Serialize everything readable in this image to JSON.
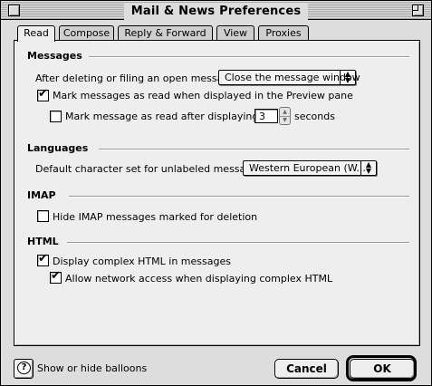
{
  "window": {
    "title": "Mail & News Preferences"
  },
  "tabs": [
    {
      "label": "Read",
      "active": true
    },
    {
      "label": "Compose",
      "active": false
    },
    {
      "label": "Reply & Forward",
      "active": false
    },
    {
      "label": "View",
      "active": false
    },
    {
      "label": "Proxies",
      "active": false
    }
  ],
  "messages": {
    "heading": "Messages",
    "after_delete_label": "After deleting or filing an open message:",
    "after_delete_value": "Close the message window",
    "mark_read_preview": {
      "label": "Mark messages as read when displayed in the Preview pane",
      "checked": true
    },
    "mark_read_after": {
      "label": "Mark message as read after displaying for",
      "checked": false,
      "seconds": "3",
      "unit": "seconds"
    }
  },
  "languages": {
    "heading": "Languages",
    "default_charset_label": "Default character set for unlabeled messages:",
    "default_charset_value": "Western European (W..."
  },
  "imap": {
    "heading": "IMAP",
    "hide_deleted": {
      "label": "Hide IMAP messages marked for deletion",
      "checked": false
    }
  },
  "html": {
    "heading": "HTML",
    "display_complex": {
      "label": "Display complex HTML in messages",
      "checked": true
    },
    "allow_network": {
      "label": "Allow network access when displaying complex HTML",
      "checked": true
    }
  },
  "footer": {
    "balloons_label": "Show or hide balloons",
    "cancel_label": "Cancel",
    "ok_label": "OK"
  },
  "icons": {
    "help": "help-balloon-icon",
    "check": "✔",
    "popup_arrows": "▲▼"
  }
}
